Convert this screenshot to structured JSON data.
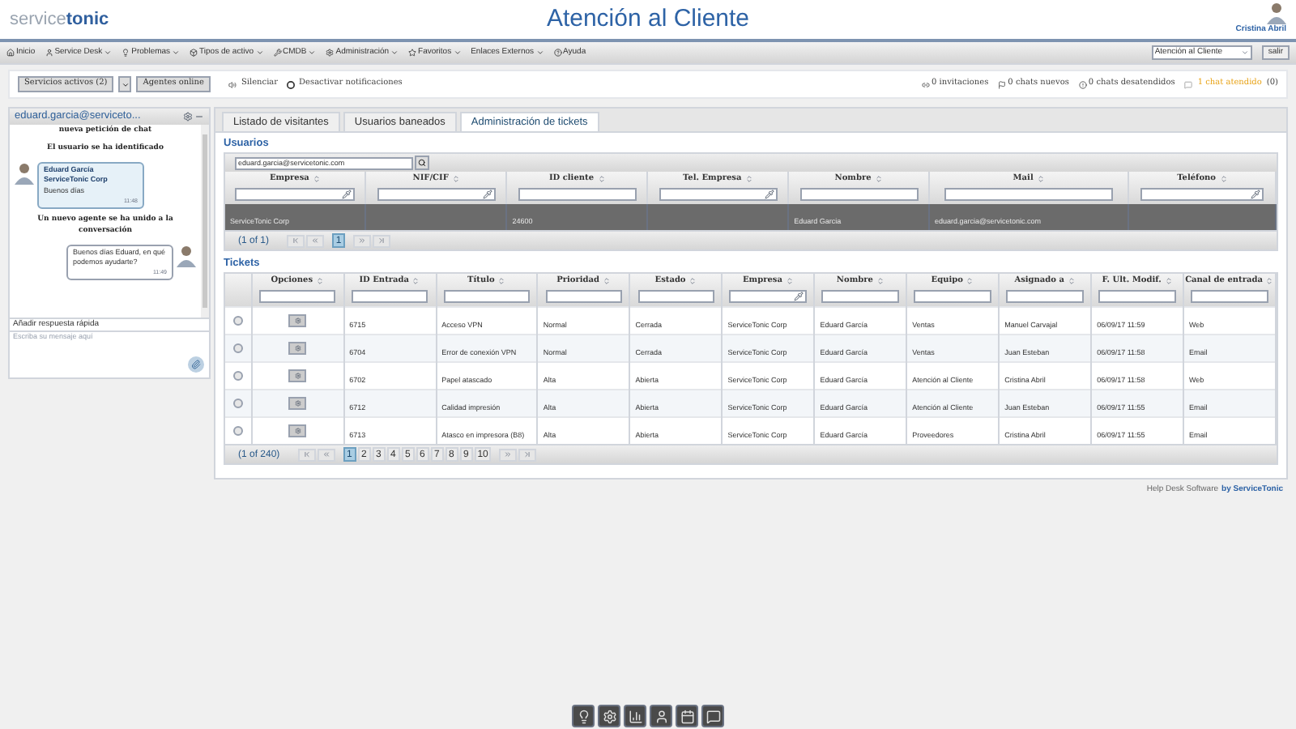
{
  "header": {
    "logo_light": "service",
    "logo_bold": "tonic",
    "title": "Atención al Cliente",
    "user_name": "Cristina Abril"
  },
  "nav": {
    "items": [
      {
        "label": "Inicio",
        "has_menu": false
      },
      {
        "label": "Service Desk",
        "has_menu": true
      },
      {
        "label": "Problemas",
        "has_menu": true
      },
      {
        "label": "Tipos de activo",
        "has_menu": true
      },
      {
        "label": "CMDB",
        "has_menu": true
      },
      {
        "label": "Administración",
        "has_menu": true
      },
      {
        "label": "Favoritos",
        "has_menu": true
      },
      {
        "label": "Enlaces Externos",
        "has_menu": true
      },
      {
        "label": "Ayuda",
        "has_menu": false
      }
    ],
    "department": "Atención al Cliente",
    "logout": "salir"
  },
  "toolbar": {
    "services_button": "Servicios activos (2)",
    "agents_button": "Agentes online",
    "silence": "Silenciar",
    "disable_notifications": "Desactivar notificaciones",
    "stats": [
      "0 invitaciones",
      "0 chats nuevos",
      "0 chats desatendidos"
    ],
    "attended": "1 chat atendido",
    "attended_count": "(0)"
  },
  "chat": {
    "title": "eduard.garcia@serviceto...",
    "messages": [
      {
        "kind": "system",
        "text": "nueva petición de chat"
      },
      {
        "kind": "system",
        "text": "El usuario se ha identificado"
      },
      {
        "kind": "incoming",
        "author": "Eduard García ServiceTonic Corp",
        "text": "Buenos días",
        "time": "11:48"
      },
      {
        "kind": "system",
        "text": "Un nuevo agente se ha unido a la conversación"
      },
      {
        "kind": "outgoing",
        "text": "Buenos días Eduard, en qué podemos ayudarte?",
        "time": "11:49"
      }
    ],
    "quick_reply": "Añadir respuesta rápida",
    "message_placeholder": "Escriba su mensaje aquí"
  },
  "tabs": [
    {
      "label": "Listado de visitantes",
      "selected": false
    },
    {
      "label": "Usuarios baneados",
      "selected": false
    },
    {
      "label": "Administración de tickets",
      "selected": true
    }
  ],
  "users": {
    "title": "Usuarios",
    "search": "eduard.garcia@servicetonic.com",
    "columns": [
      {
        "label": "Empresa",
        "kind": "picker"
      },
      {
        "label": "NIF/CIF",
        "kind": "picker"
      },
      {
        "label": "ID cliente",
        "kind": "text"
      },
      {
        "label": "Tel. Empresa",
        "kind": "picker"
      },
      {
        "label": "Nombre",
        "kind": "text"
      },
      {
        "label": "Mail",
        "kind": "text"
      },
      {
        "label": "Teléfono",
        "kind": "picker"
      }
    ],
    "rows": [
      {
        "selected": true,
        "cells": [
          "ServiceTonic Corp",
          "",
          "24600",
          "",
          "Eduard Garcia",
          "eduard.garcia@servicetonic.com",
          ""
        ]
      }
    ],
    "pager": "(1 of 1)",
    "pages": [
      {
        "label": "1",
        "selected": true
      }
    ]
  },
  "tickets": {
    "title": "Tickets",
    "columns": [
      {
        "label": "Opciones",
        "kind": "text"
      },
      {
        "label": "ID Entrada",
        "kind": "text"
      },
      {
        "label": "Título",
        "kind": "text"
      },
      {
        "label": "Prioridad",
        "kind": "text"
      },
      {
        "label": "Estado",
        "kind": "text"
      },
      {
        "label": "Empresa",
        "kind": "picker"
      },
      {
        "label": "Nombre",
        "kind": "text"
      },
      {
        "label": "Equipo",
        "kind": "text"
      },
      {
        "label": "Asignado a",
        "kind": "text"
      },
      {
        "label": "F. Ult. Modif.",
        "kind": "text"
      },
      {
        "label": "Canal de entrada",
        "kind": "text"
      }
    ],
    "rows": [
      {
        "selected": false,
        "cells": [
          "",
          "6715",
          "Acceso VPN",
          "Normal",
          "Cerrada",
          "ServiceTonic Corp",
          "Eduard García",
          "Ventas",
          "Manuel Carvajal",
          "06/09/17 11:59",
          "Web"
        ]
      },
      {
        "selected": false,
        "cells": [
          "",
          "6704",
          "Error de conexión VPN",
          "Normal",
          "Cerrada",
          "ServiceTonic Corp",
          "Eduard García",
          "Ventas",
          "Juan Esteban",
          "06/09/17 11:58",
          "Email"
        ]
      },
      {
        "selected": false,
        "cells": [
          "",
          "6702",
          "Papel atascado",
          "Alta",
          "Abierta",
          "ServiceTonic Corp",
          "Eduard García",
          "Atención al Cliente",
          "Cristina Abril",
          "06/09/17 11:58",
          "Web"
        ]
      },
      {
        "selected": false,
        "cells": [
          "",
          "6712",
          "Calidad impresión",
          "Alta",
          "Abierta",
          "ServiceTonic Corp",
          "Eduard García",
          "Atención al Cliente",
          "Juan Esteban",
          "06/09/17 11:55",
          "Email"
        ]
      },
      {
        "selected": false,
        "cells": [
          "",
          "6713",
          "Atasco en impresora (B8)",
          "Alta",
          "Abierta",
          "ServiceTonic Corp",
          "Eduard García",
          "Proveedores",
          "Cristina Abril",
          "06/09/17 11:55",
          "Email"
        ]
      }
    ],
    "pager": "(1 of 240)",
    "pages": [
      {
        "label": "1",
        "selected": true
      },
      {
        "label": "2",
        "selected": false
      },
      {
        "label": "3",
        "selected": false
      },
      {
        "label": "4",
        "selected": false
      },
      {
        "label": "5",
        "selected": false
      },
      {
        "label": "6",
        "selected": false
      },
      {
        "label": "7",
        "selected": false
      },
      {
        "label": "8",
        "selected": false
      },
      {
        "label": "9",
        "selected": false
      },
      {
        "label": "10",
        "selected": false
      }
    ]
  },
  "footer": {
    "text": "Help Desk Software",
    "brand": "by ServiceTonic"
  }
}
